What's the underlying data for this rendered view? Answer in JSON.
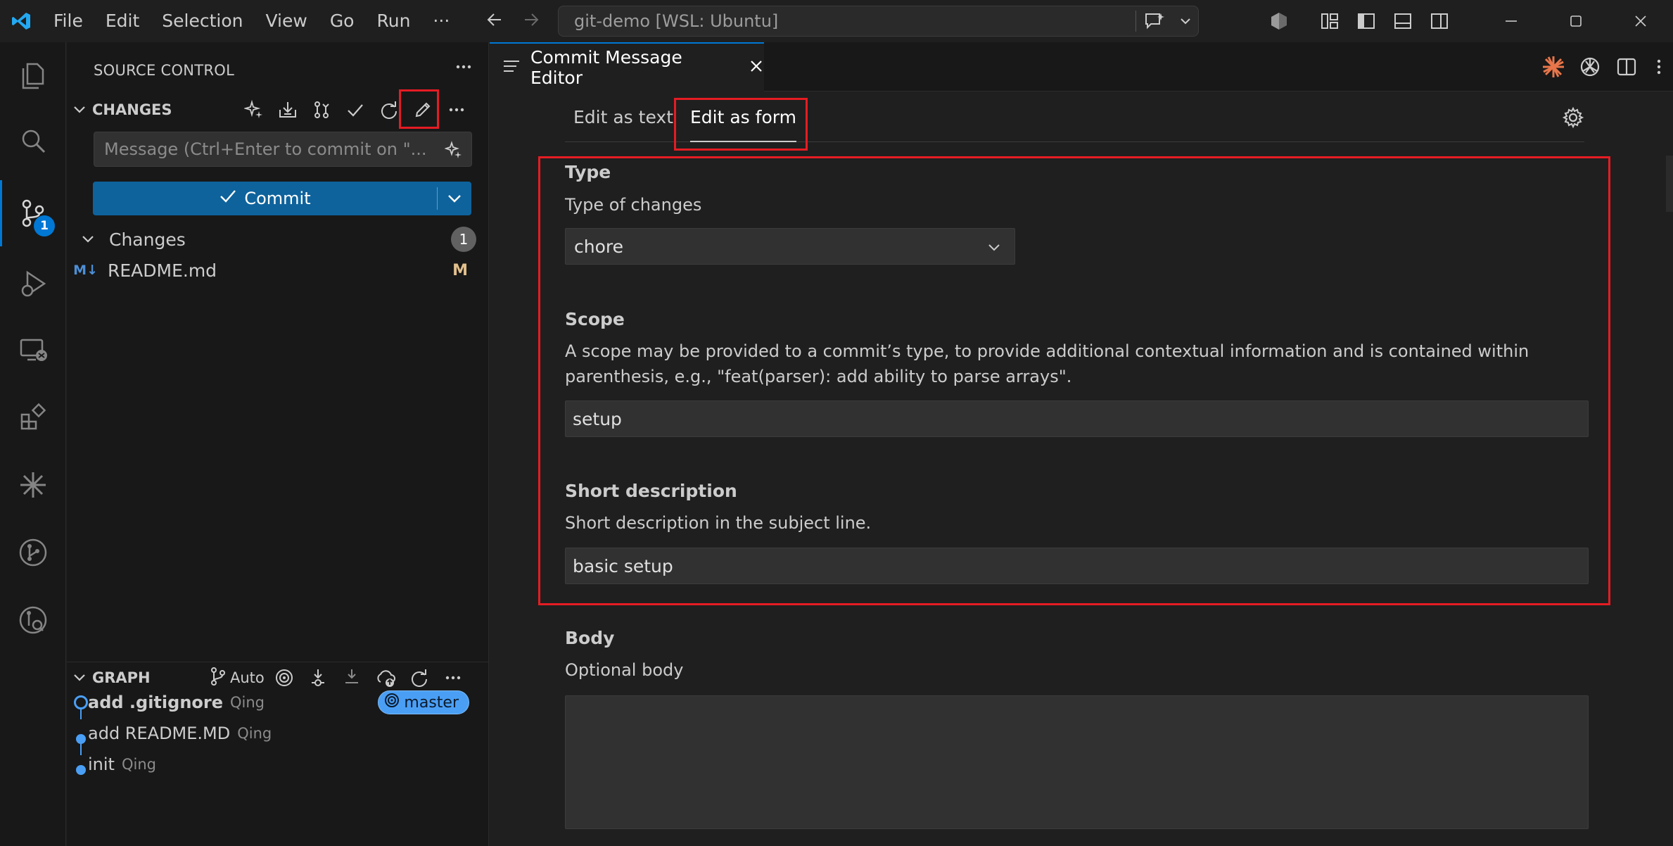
{
  "titlebar": {
    "menu": [
      "File",
      "Edit",
      "Selection",
      "View",
      "Go",
      "Run"
    ],
    "more": "···",
    "command_center": "git-demo [WSL: Ubuntu]"
  },
  "activity": {
    "scm_badge": "1"
  },
  "sidebar": {
    "title": "SOURCE CONTROL",
    "changes_section": "CHANGES",
    "message_placeholder": "Message (Ctrl+Enter to commit on \"...",
    "commit_label": "Commit",
    "changes_group": "Changes",
    "changes_count": "1",
    "files": [
      {
        "icon": "M↓",
        "name": "README.md",
        "status": "M"
      }
    ],
    "graph_section": "GRAPH",
    "graph_auto": "Auto",
    "commits": [
      {
        "message": "add .gitignore",
        "author": "Qing",
        "branch": "master"
      },
      {
        "message": "add README.MD",
        "author": "Qing"
      },
      {
        "message": "init",
        "author": "Qing"
      }
    ]
  },
  "editor": {
    "tab_title": "Commit Message Editor",
    "form_tabs": [
      "Edit as text",
      "Edit as form"
    ],
    "type": {
      "label": "Type",
      "desc": "Type of changes",
      "value": "chore"
    },
    "scope": {
      "label": "Scope",
      "desc": "A scope may be provided to a commit’s type, to provide additional contextual information and is contained within parenthesis, e.g., \"feat(parser): add ability to parse arrays\".",
      "value": "setup"
    },
    "short": {
      "label": "Short description",
      "desc": "Short description in the subject line.",
      "value": "basic setup"
    },
    "body": {
      "label": "Body",
      "desc": "Optional body",
      "value": ""
    }
  },
  "colors": {
    "accent": "#0078d4",
    "highlight": "#e51c23",
    "branch": "#4a9ff5",
    "modified": "#e2c08d"
  }
}
